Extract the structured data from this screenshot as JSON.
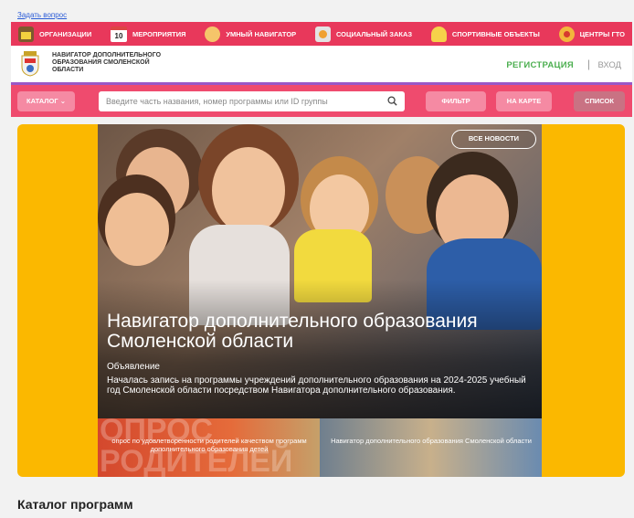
{
  "top_link": "Задать вопрос",
  "nav": [
    {
      "label": "Организации",
      "icon": "building-icon"
    },
    {
      "label": "Мероприятия",
      "icon": "calendar-icon",
      "badge": "10"
    },
    {
      "label": "Умный навигатор",
      "icon": "people-icon"
    },
    {
      "label": "Социальный заказ",
      "icon": "document-icon"
    },
    {
      "label": "Спортивные объекты",
      "icon": "sport-icon"
    },
    {
      "label": "Центры ГТО",
      "icon": "badge-icon"
    }
  ],
  "header": {
    "brand": "Навигатор дополнительного образования Смоленской области",
    "register": "Регистрация",
    "separator": "|",
    "login": "Вход"
  },
  "search": {
    "catalog": "Каталог",
    "placeholder": "Введите часть названия, номер программы или ID группы",
    "filter": "Фильтр",
    "map": "На карте",
    "list": "Список"
  },
  "hero": {
    "all_news": "Все новости",
    "title": "Навигатор дополнительного образования Смоленской области",
    "subtitle": "Объявление",
    "text": "Началась запись на программы учреждений дополнительного образования на 2024-2025 учебный год Смоленской области посредством Навигатора дополнительного образования."
  },
  "thumbnails": [
    {
      "big_text": "ОПРОС РОДИТЕЛЕЙ",
      "label": "опрос по удовлетворенности родителей качеством программ дополнительного образования детей"
    },
    {
      "label": "Навигатор дополнительного образования Смоленской области"
    }
  ],
  "catalog_title": "Каталог программ",
  "colors": {
    "nav_bg": "#e8385b",
    "search_bg": "#ef4b6e",
    "hero_bg": "#fbb800",
    "register": "#4caf50"
  }
}
